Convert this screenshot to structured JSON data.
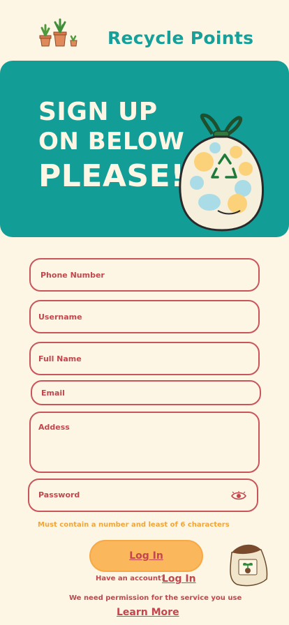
{
  "app": {
    "title": "Recycle Points"
  },
  "hero": {
    "line1": "SIGN UP",
    "line2": "ON BELOW",
    "line3": "PLEASE!"
  },
  "form": {
    "phone_placeholder": "Phone Number",
    "username_placeholder": "Username",
    "fullname_placeholder": "Full Name",
    "email_placeholder": "Email",
    "address_placeholder": "Addess",
    "password_placeholder": "Password",
    "password_hint": "Must contain a number and least of 6 characters"
  },
  "actions": {
    "login_button": "Log In",
    "account_prompt": "Have an account?",
    "account_link": "Log In",
    "permission_text": "We need permission for the service you use",
    "learn_more": "Learn More"
  },
  "colors": {
    "background": "#fdf6e4",
    "teal": "#129d97",
    "accent_red": "#c2464c",
    "button_orange": "#fbb75c",
    "hint_orange": "#f0a53a"
  },
  "icons": [
    "potted-plants-icon",
    "recycle-bag-illustration",
    "eye-icon",
    "seed-bag-illustration"
  ]
}
